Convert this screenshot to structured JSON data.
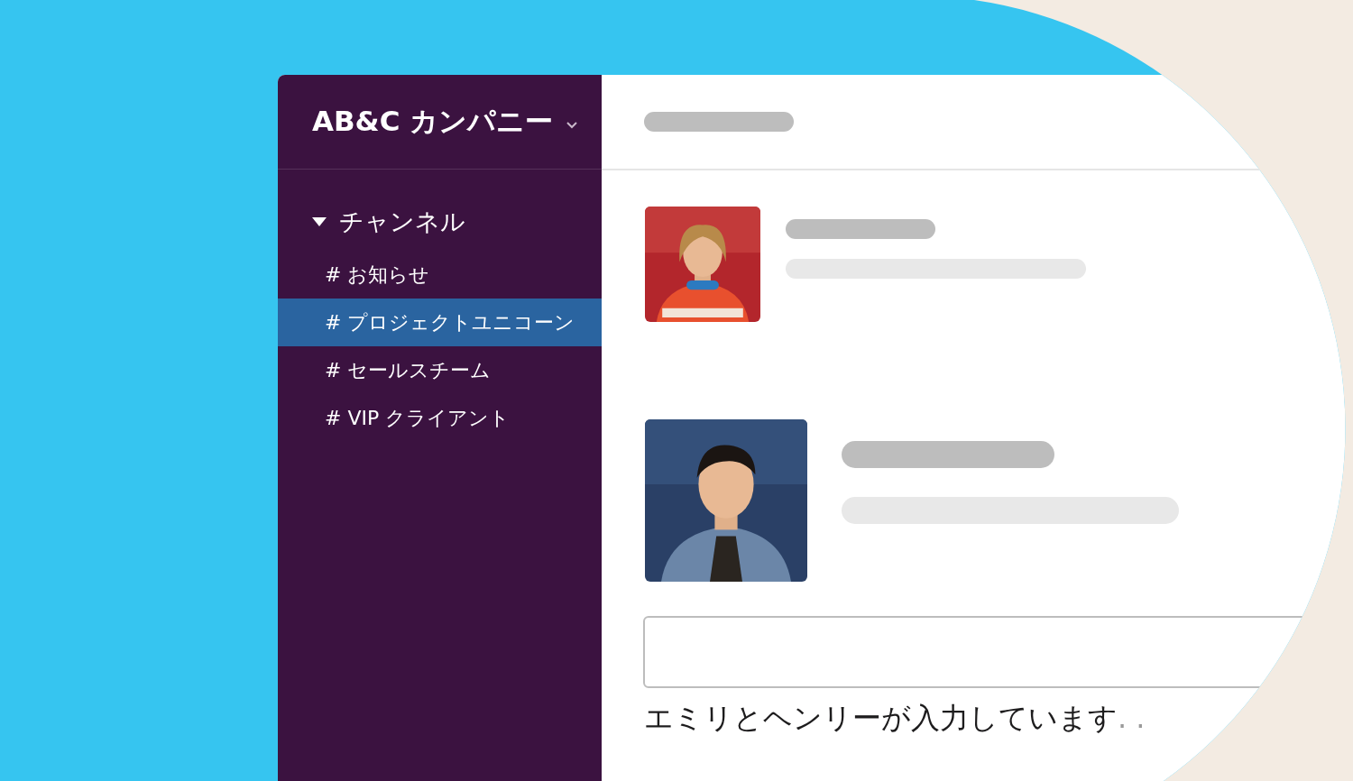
{
  "workspace": {
    "name": "AB&C カンパニー"
  },
  "sidebar": {
    "section": {
      "label": "チャンネル",
      "expanded": true
    },
    "channels": [
      {
        "label": "# お知らせ",
        "selected": false
      },
      {
        "label": "# プロジェクトユニコーン",
        "selected": true
      },
      {
        "label": "# セールスチーム",
        "selected": false
      },
      {
        "label": "# VIP クライアント",
        "selected": false
      }
    ]
  },
  "composer": {
    "typing_text": "エミリとヘンリーが入力しています",
    "typing_dots": ". ."
  }
}
